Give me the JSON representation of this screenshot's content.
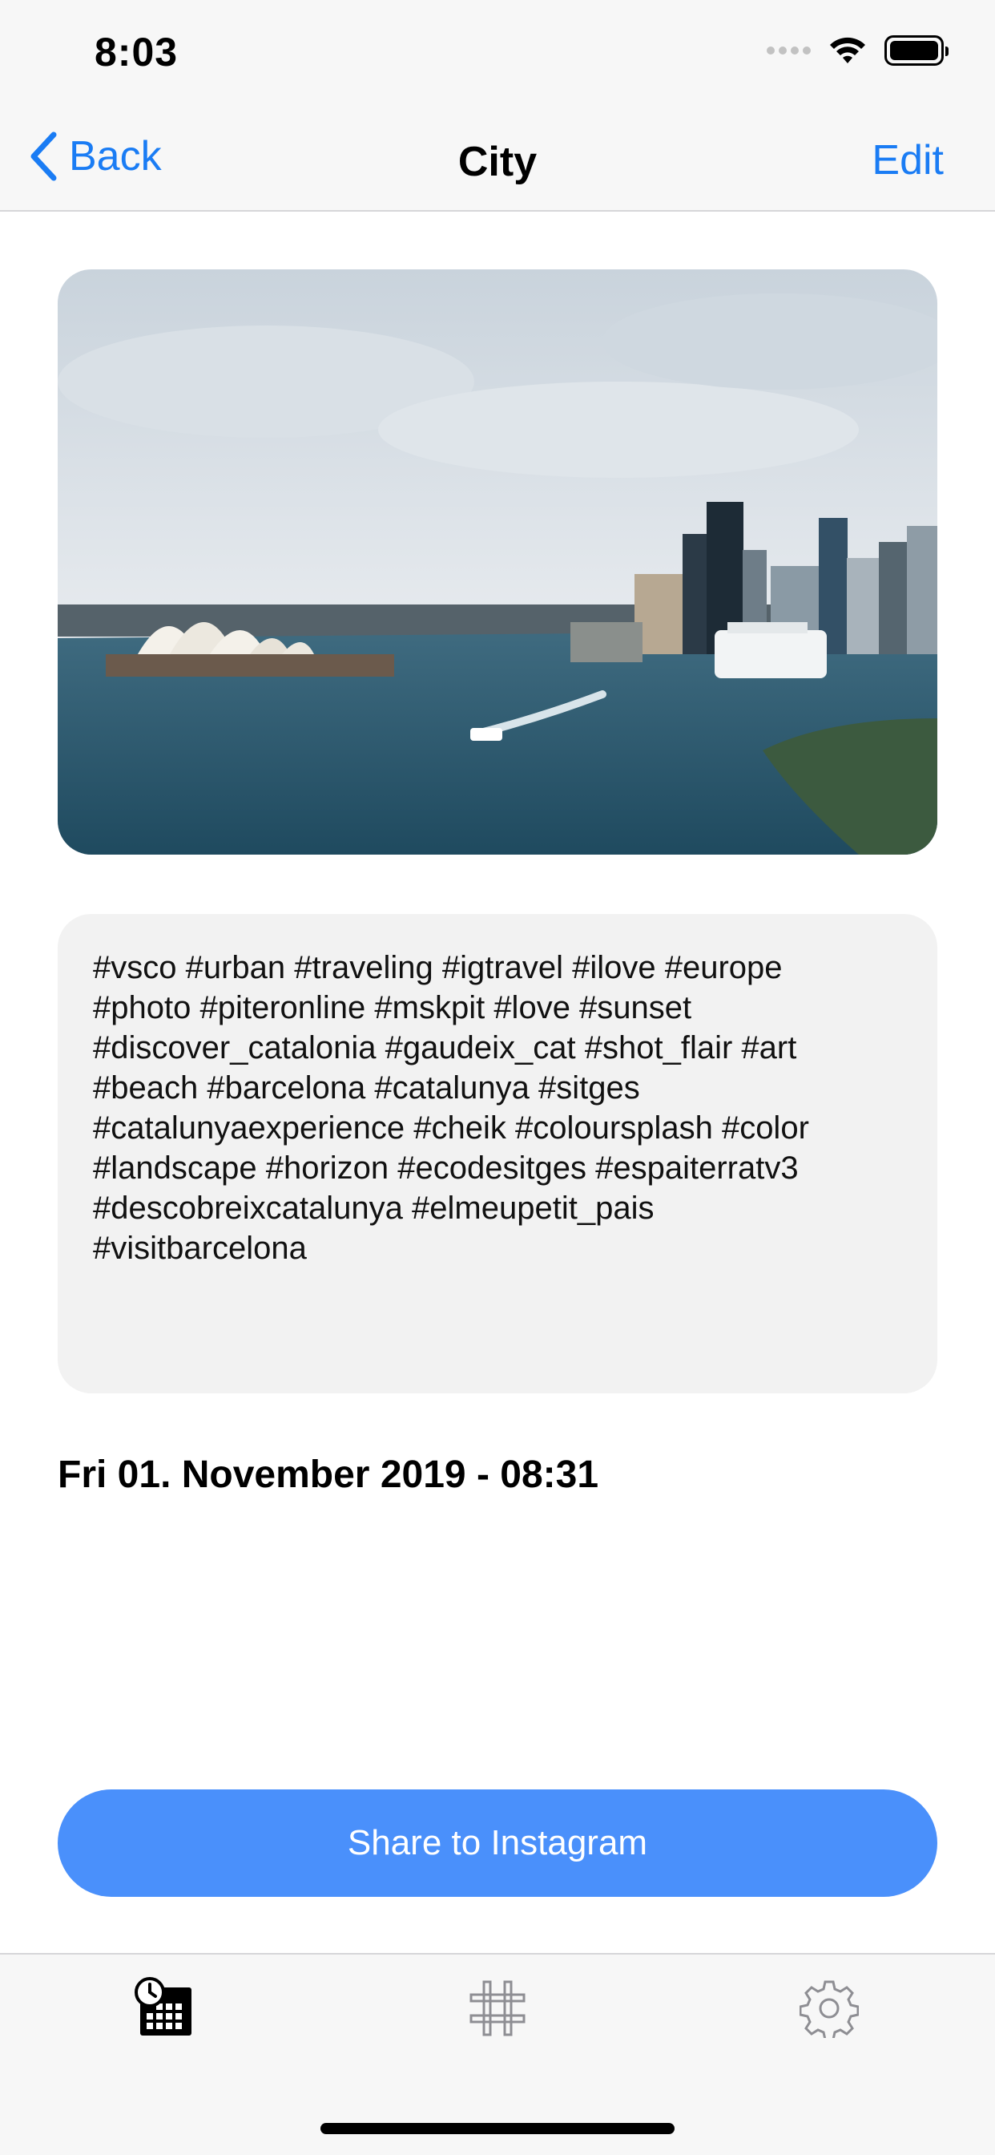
{
  "status_bar": {
    "time": "8:03"
  },
  "nav": {
    "back_label": "Back",
    "title": "City",
    "edit_label": "Edit"
  },
  "post": {
    "tags": "#vsco #urban #traveling #igtravel #ilove #europe\n#photo #piteronline #mskpit #love #sunset\n#discover_catalonia #gaudeix_cat #shot_flair #art\n#beach #barcelona #catalunya #sitges\n#catalunyaexperience #cheik #coloursplash #color\n#landscape #horizon #ecodesitges #espaiterratv3\n#descobreixcatalunya #elmeupetit_pais\n#visitbarcelona",
    "date": "Fri 01. November 2019 - 08:31",
    "share_label": "Share to Instagram"
  },
  "tabs": [
    {
      "icon": "calendar-clock-icon",
      "active": true
    },
    {
      "icon": "hashtag-icon",
      "active": false
    },
    {
      "icon": "gear-icon",
      "active": false
    }
  ],
  "colors": {
    "accent": "#1a7cf4",
    "button": "#4a90fb",
    "inactive_icon": "#8e8e93"
  }
}
